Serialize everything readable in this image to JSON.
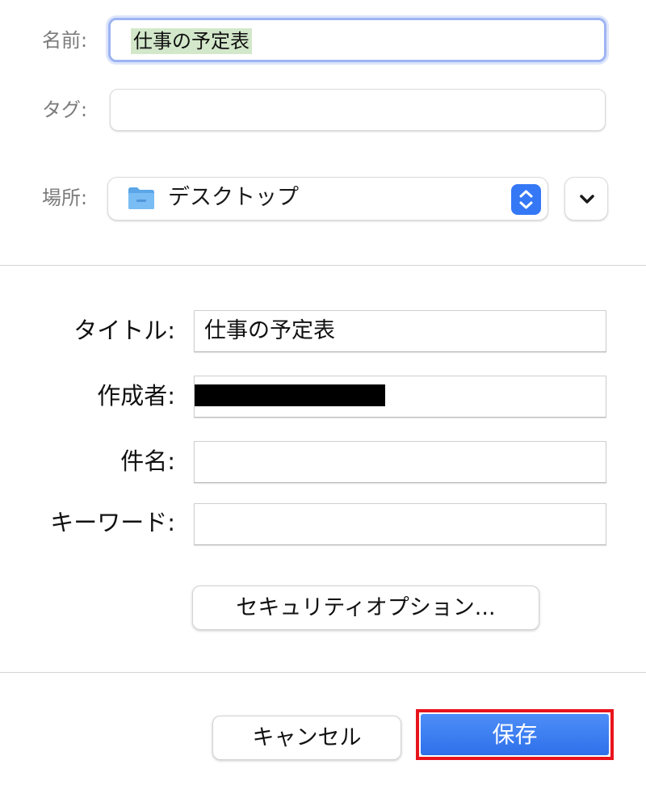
{
  "save_sheet": {
    "name_label": "名前:",
    "name_value": "仕事の予定表",
    "tags_label": "タグ:",
    "tags_value": "",
    "location_label": "場所:",
    "location_value": "デスクトップ",
    "location_icon": "folder-icon",
    "expand_icon": "chevron-down-icon"
  },
  "pdf_options": {
    "title_label": "タイトル:",
    "title_value": "仕事の予定表",
    "author_label": "作成者:",
    "author_value": "",
    "subject_label": "件名:",
    "subject_value": "",
    "keywords_label": "キーワード:",
    "keywords_value": "",
    "security_button_label": "セキュリティオプション..."
  },
  "footer": {
    "cancel_label": "キャンセル",
    "save_label": "保存"
  },
  "colors": {
    "accent": "#3478f6",
    "focus_ring": "#9db4f3",
    "selection": "#d3e8ca",
    "highlight_box": "#e8141c"
  }
}
